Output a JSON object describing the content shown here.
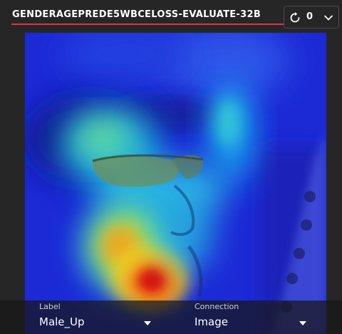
{
  "header": {
    "title": "GENDERAGEPREDE5WBCELOSS-EVALUATE-32B",
    "refresh_icon": "refresh-icon",
    "count": "0",
    "menu_icon": "chevron-down-icon"
  },
  "viewer": {
    "image_description_icon": "heatmap-overlay-image"
  },
  "controls": {
    "label_field": {
      "label": "Label",
      "value": "Male_Up"
    },
    "connection_field": {
      "label": "Connection",
      "value": "Image"
    }
  },
  "colors": {
    "accent_underline": "#e0344b",
    "background": "#262626"
  }
}
